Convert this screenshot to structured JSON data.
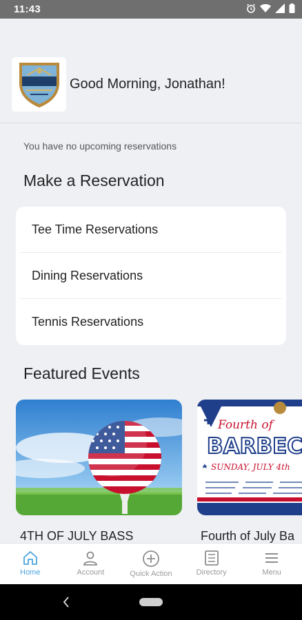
{
  "status_bar": {
    "time": "11:43"
  },
  "header": {
    "greeting": "Good Morning, Jonathan!",
    "logo_icon": "club-crest-icon"
  },
  "main": {
    "no_reservations_text": "You have no upcoming reservations",
    "reservation_section_title": "Make a Reservation",
    "reservation_items": [
      {
        "label": "Tee Time Reservations"
      },
      {
        "label": "Dining Reservations"
      },
      {
        "label": "Tennis Reservations"
      }
    ],
    "events_section_title": "Featured Events",
    "events": [
      {
        "title": "4TH OF JULY BASS"
      },
      {
        "title": "Fourth of July Ba",
        "image_text": {
          "line1": "Fourth of",
          "line2": "BARBEC",
          "line3": "SUNDAY, JULY 4th"
        }
      }
    ]
  },
  "bottom_nav": {
    "items": [
      {
        "label": "Home",
        "icon": "home-icon",
        "active": true
      },
      {
        "label": "Account",
        "icon": "person-icon",
        "active": false
      },
      {
        "label": "Quick Action",
        "icon": "plus-circle-icon",
        "active": false
      },
      {
        "label": "Directory",
        "icon": "directory-icon",
        "active": false
      },
      {
        "label": "Menu",
        "icon": "hamburger-icon",
        "active": false
      }
    ]
  },
  "colors": {
    "accent": "#4aa3df",
    "background": "#eef0f4",
    "status_bar": "#6f6f6f"
  }
}
